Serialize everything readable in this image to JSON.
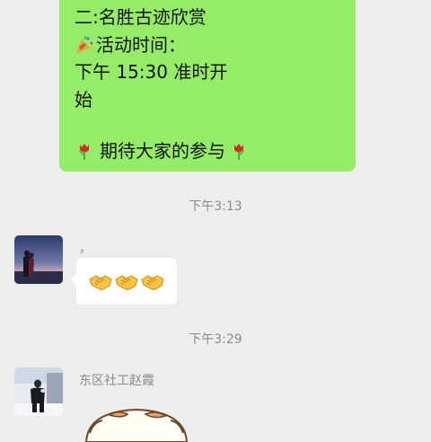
{
  "message_top": {
    "line1": "二:名胜古迹欣赏",
    "line2": "活动时间：",
    "line3": "下午 15:30 准时开",
    "line4": "始",
    "line5": "期待大家的参与",
    "emoji_party": "party-popper-icon",
    "emoji_tulip": "tulip-icon"
  },
  "timestamp1": "下午3:13",
  "message_mid": {
    "sender_name": "，",
    "emoji": "handshake-icon",
    "emoji_count": 3
  },
  "timestamp2": "下午3:29",
  "message_bottom": {
    "sender_name": "东区社工赵霞",
    "content": "sticker"
  },
  "colors": {
    "background": "#ededed",
    "self_bubble": "#95ec69",
    "other_bubble": "#ffffff",
    "meta_text": "#8a8a8a"
  }
}
